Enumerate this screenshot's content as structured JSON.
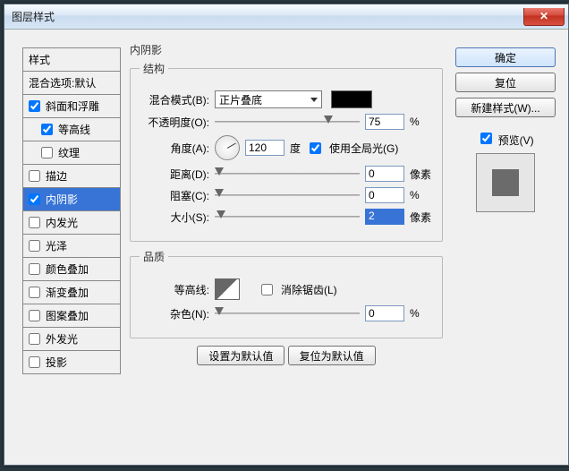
{
  "window": {
    "title": "图层样式"
  },
  "styles": {
    "header": "样式",
    "blendOptions": "混合选项:默认",
    "items": [
      {
        "label": "斜面和浮雕",
        "checked": true,
        "indent": false
      },
      {
        "label": "等高线",
        "checked": true,
        "indent": true
      },
      {
        "label": "纹理",
        "checked": false,
        "indent": true
      },
      {
        "label": "描边",
        "checked": false,
        "indent": false
      },
      {
        "label": "内阴影",
        "checked": true,
        "indent": false,
        "selected": true
      },
      {
        "label": "内发光",
        "checked": false,
        "indent": false
      },
      {
        "label": "光泽",
        "checked": false,
        "indent": false
      },
      {
        "label": "颜色叠加",
        "checked": false,
        "indent": false
      },
      {
        "label": "渐变叠加",
        "checked": false,
        "indent": false
      },
      {
        "label": "图案叠加",
        "checked": false,
        "indent": false
      },
      {
        "label": "外发光",
        "checked": false,
        "indent": false
      },
      {
        "label": "投影",
        "checked": false,
        "indent": false
      }
    ]
  },
  "panel": {
    "title": "内阴影",
    "structure": {
      "legend": "结构",
      "blendModeLabel": "混合模式(B):",
      "blendModeValue": "正片叠底",
      "colorSwatch": "#000000",
      "opacityLabel": "不透明度(O):",
      "opacityValue": "75",
      "opacityUnit": "%",
      "angleLabel": "角度(A):",
      "angleValue": "120",
      "angleUnit": "度",
      "globalLightLabel": "使用全局光(G)",
      "globalLightChecked": true,
      "distanceLabel": "距离(D):",
      "distanceValue": "0",
      "distanceUnit": "像素",
      "chokeLabel": "阻塞(C):",
      "chokeValue": "0",
      "chokeUnit": "%",
      "sizeLabel": "大小(S):",
      "sizeValue": "2",
      "sizeUnit": "像素"
    },
    "quality": {
      "legend": "品质",
      "contourLabel": "等高线:",
      "antiAliasLabel": "消除锯齿(L)",
      "antiAliasChecked": false,
      "noiseLabel": "杂色(N):",
      "noiseValue": "0",
      "noiseUnit": "%"
    },
    "setDefault": "设置为默认值",
    "resetDefault": "复位为默认值"
  },
  "buttons": {
    "ok": "确定",
    "cancel": "复位",
    "newStyle": "新建样式(W)...",
    "previewLabel": "预览(V)",
    "previewChecked": true
  }
}
